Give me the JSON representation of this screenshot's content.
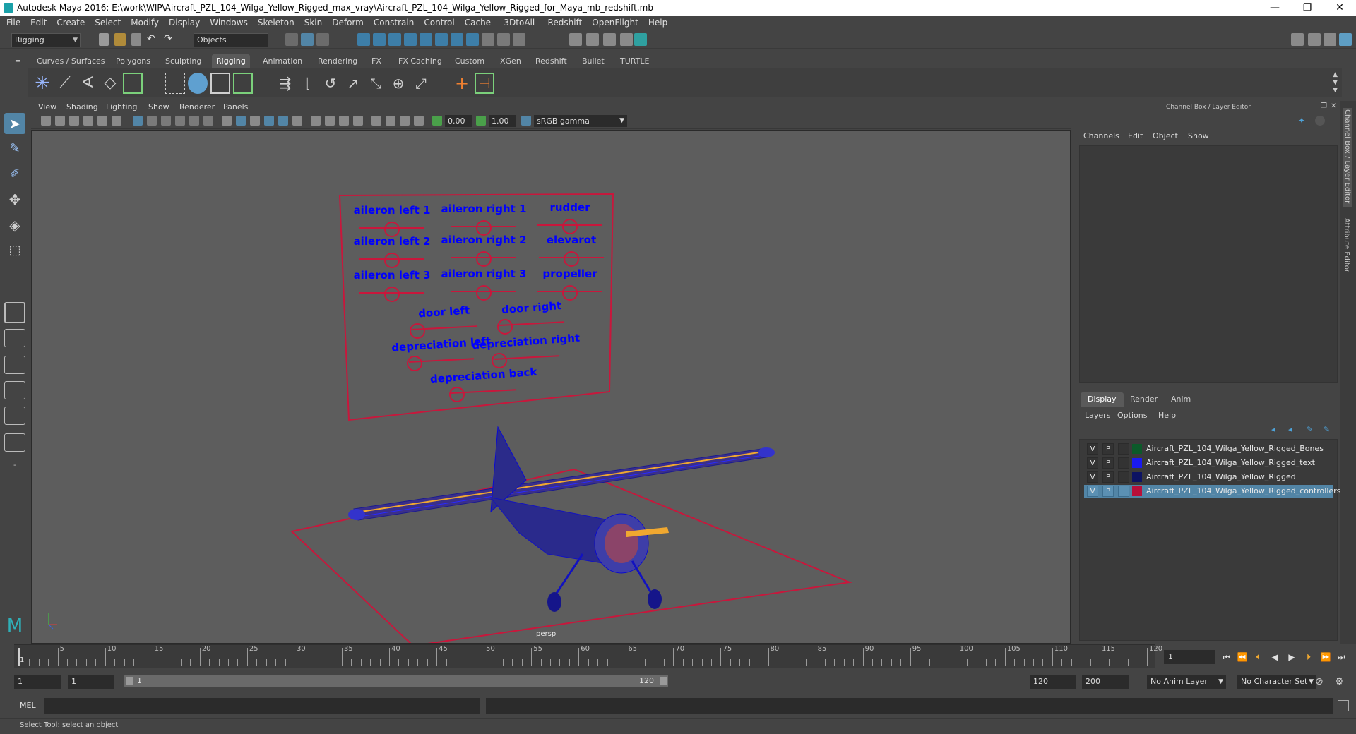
{
  "window": {
    "title": "Autodesk Maya 2016: E:\\work\\WIP\\Aircraft_PZL_104_Wilga_Yellow_Rigged_max_vray\\Aircraft_PZL_104_Wilga_Yellow_Rigged_for_Maya_mb_redshift.mb",
    "minimize": "—",
    "maximize": "❐",
    "close": "✕"
  },
  "menubar": [
    "File",
    "Edit",
    "Create",
    "Select",
    "Modify",
    "Display",
    "Windows",
    "Skeleton",
    "Skin",
    "Deform",
    "Constrain",
    "Control",
    "Cache",
    "-3DtoAll-",
    "Redshift",
    "OpenFlight",
    "Help"
  ],
  "statusline": {
    "menuset": "Rigging",
    "selection_mode": "Objects"
  },
  "shelf": {
    "tabs": [
      "Curves / Surfaces",
      "Polygons",
      "Sculpting",
      "Rigging",
      "Animation",
      "Rendering",
      "FX",
      "FX Caching",
      "Custom",
      "XGen",
      "Redshift",
      "Bullet",
      "TURTLE"
    ],
    "active_tab": "Rigging"
  },
  "viewport": {
    "menus": [
      "View",
      "Shading",
      "Lighting",
      "Show",
      "Renderer",
      "Panels"
    ],
    "exposure": "0.00",
    "gamma": "1.00",
    "color_space": "sRGB gamma",
    "camera_label": "persp",
    "controls": [
      "aileron left 1",
      "aileron right 1",
      "rudder",
      "aileron left 2",
      "aileron right 2",
      "elevarot",
      "aileron left 3",
      "aileron right 3",
      "propeller",
      "door left",
      "door right",
      "depreciation left",
      "depreciation right",
      "depreciation back"
    ],
    "control_color": "#0000ff",
    "rig_color": "#c8173c"
  },
  "right_panel": {
    "title": "Channel Box / Layer Editor",
    "channel_menus": [
      "Channels",
      "Edit",
      "Object",
      "Show"
    ],
    "tabs": [
      "Display",
      "Render",
      "Anim"
    ],
    "active_tab": "Display",
    "layer_menus": [
      "Layers",
      "Options",
      "Help"
    ],
    "layers": [
      {
        "v": "V",
        "p": "P",
        "name": "Aircraft_PZL_104_Wilga_Yellow_Rigged_Bones",
        "color": "#0c5a2a",
        "selected": false
      },
      {
        "v": "V",
        "p": "P",
        "name": "Aircraft_PZL_104_Wilga_Yellow_Rigged_text",
        "color": "#1a1af0",
        "selected": false
      },
      {
        "v": "V",
        "p": "P",
        "name": "Aircraft_PZL_104_Wilga_Yellow_Rigged",
        "color": "#0d1363",
        "selected": false
      },
      {
        "v": "V",
        "p": "P",
        "name": "Aircraft_PZL_104_Wilga_Yellow_Rigged_controllers",
        "color": "#b8103a",
        "selected": true
      }
    ],
    "side_tabs": [
      "Channel Box / Layer Editor",
      "Attribute Editor"
    ]
  },
  "timeline": {
    "ticks": [
      "5",
      "10",
      "15",
      "20",
      "25",
      "30",
      "35",
      "40",
      "45",
      "50",
      "55",
      "60",
      "65",
      "70",
      "75",
      "80",
      "85",
      "90",
      "95",
      "100",
      "105",
      "110",
      "115",
      "120"
    ],
    "start_label": "1",
    "current_frame": "1"
  },
  "range": {
    "start": "1",
    "playback_start": "1",
    "slider_start": "1",
    "slider_end": "120",
    "playback_end": "120",
    "end": "200",
    "anim_layer": "No Anim Layer",
    "character_set": "No Character Set"
  },
  "command": {
    "label": "MEL"
  },
  "help_line": "Select Tool: select an object"
}
